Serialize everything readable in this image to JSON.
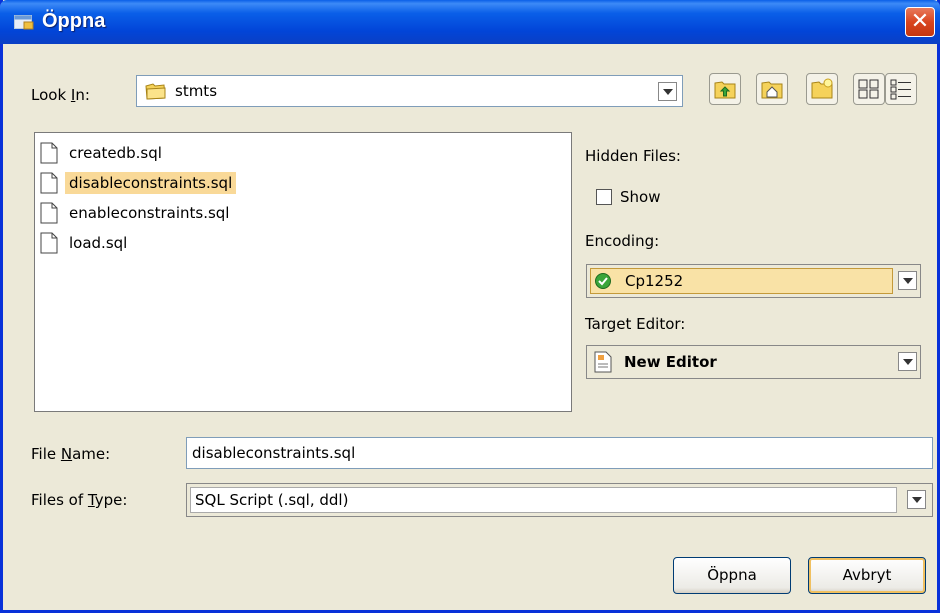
{
  "window": {
    "title": "Öppna",
    "close_glyph": "✕"
  },
  "look_in": {
    "label_pre": "Look ",
    "label_mnemonic": "I",
    "label_post": "n:",
    "value": "stmts"
  },
  "toolbar": {
    "icons": [
      "up-folder-icon",
      "home-icon",
      "new-folder-icon",
      "list-view-icon",
      "details-view-icon"
    ]
  },
  "files": [
    {
      "name": "createdb.sql",
      "selected": false
    },
    {
      "name": "disableconstraints.sql",
      "selected": true
    },
    {
      "name": "enableconstraints.sql",
      "selected": false
    },
    {
      "name": "load.sql",
      "selected": false
    }
  ],
  "hidden_files": {
    "label": "Hidden Files:",
    "show_label": "Show",
    "checked": false
  },
  "encoding": {
    "label": "Encoding:",
    "value": "Cp1252"
  },
  "target_editor": {
    "label": "Target Editor:",
    "value": "New Editor"
  },
  "file_name": {
    "label_pre": "File ",
    "label_mnemonic": "N",
    "label_post": "ame:",
    "value": "disableconstraints.sql"
  },
  "file_type": {
    "label_pre": "Files of ",
    "label_mnemonic": "T",
    "label_post": "ype:",
    "value": "SQL Script (.sql, ddl)"
  },
  "buttons": {
    "open_label": "Öppna",
    "cancel_label": "Avbryt"
  }
}
